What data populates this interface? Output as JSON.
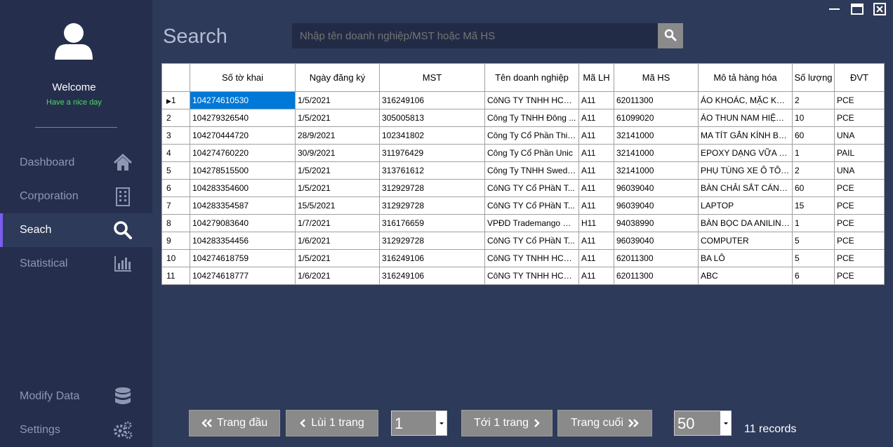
{
  "window": {
    "minimize_icon": "minimize-icon",
    "maximize_icon": "maximize-icon",
    "close_icon": "close-icon"
  },
  "sidebar": {
    "welcome": "Welcome",
    "subtitle": "Have a nice day",
    "items": [
      {
        "label": "Dashboard",
        "icon": "home-icon"
      },
      {
        "label": "Corporation",
        "icon": "building-icon"
      },
      {
        "label": "Seach",
        "icon": "search-icon",
        "active": true
      },
      {
        "label": "Statistical",
        "icon": "bar-chart-icon"
      },
      {
        "label": "Modify Data",
        "icon": "database-icon"
      },
      {
        "label": "Settings",
        "icon": "gears-icon"
      }
    ]
  },
  "search": {
    "title": "Search",
    "placeholder": "Nhập tên doanh nghiệp/MST hoặc Mã HS"
  },
  "table": {
    "columns": [
      "Số tờ khai",
      "Ngày đăng ký",
      "MST",
      "Tên doanh nghiệp",
      "Mã LH",
      "Mã HS",
      "Mô tả hàng hóa",
      "Số lượng",
      "ĐVT"
    ],
    "rows": [
      {
        "n": "1",
        "so": "104274610530",
        "ngay": "1/5/2021",
        "mst": "316249106",
        "ten": "CôNG TY TNHH HCM...",
        "malh": "A11",
        "mahs": "62011300",
        "mota": "ÁO KHOÁC, MẶC KHI...",
        "sl": "2",
        "dvt": "PCE"
      },
      {
        "n": "2",
        "so": "104279326540",
        "ngay": "1/5/2021",
        "mst": "305005813",
        "ten": "Công Ty TNHH Đông ...",
        "malh": "A11",
        "mahs": "61099020",
        "mota": "ÁO THUN NAM HIỆU ...",
        "sl": "10",
        "dvt": "PCE"
      },
      {
        "n": "3",
        "so": "104270444720",
        "ngay": "28/9/2021",
        "mst": "102341802",
        "ten": "Công Ty Cổ Phần Thiế...",
        "malh": "A11",
        "mahs": "32141000",
        "mota": "MA TÍT GẮN KÍNH BE...",
        "sl": "60",
        "dvt": "UNA"
      },
      {
        "n": "4",
        "so": "104274760220",
        "ngay": "30/9/2021",
        "mst": "311976429",
        "ten": "Công Ty Cổ Phần Unic",
        "malh": "A11",
        "mahs": "32141000",
        "mota": "EPOXY DẠNG VỮA DÙ...",
        "sl": "1",
        "dvt": "PAIL"
      },
      {
        "n": "5",
        "so": "104278515500",
        "ngay": "1/5/2021",
        "mst": "313761612",
        "ten": "Công Ty TNHH Swede...",
        "malh": "A11",
        "mahs": "32141000",
        "mota": "PHỤ TÙNG XE Ô TÔ C...",
        "sl": "2",
        "dvt": "UNA"
      },
      {
        "n": "6",
        "so": "104283354600",
        "ngay": "1/5/2021",
        "mst": "312929728",
        "ten": "CôNG TY Cổ PHầN T...",
        "malh": "A11",
        "mahs": "96039040",
        "mota": "BÀN CHẢI SẮT CÁN G...",
        "sl": "60",
        "dvt": "PCE"
      },
      {
        "n": "7",
        "so": "104283354587",
        "ngay": "15/5/2021",
        "mst": "312929728",
        "ten": "CôNG TY Cổ PHầN T...",
        "malh": "A11",
        "mahs": "96039040",
        "mota": "LAPTOP",
        "sl": "15",
        "dvt": "PCE"
      },
      {
        "n": "8",
        "so": "104279083640",
        "ngay": "1/7/2021",
        "mst": "316176659",
        "ten": "VPĐD Trademango So...",
        "malh": "H11",
        "mahs": "94038990",
        "mota": "BÀN BỌC DA ANILIN, ...",
        "sl": "1",
        "dvt": "PCE"
      },
      {
        "n": "9",
        "so": "104283354456",
        "ngay": "1/6/2021",
        "mst": "312929728",
        "ten": "CôNG TY Cổ PHầN T...",
        "malh": "A11",
        "mahs": "96039040",
        "mota": "COMPUTER",
        "sl": "5",
        "dvt": "PCE"
      },
      {
        "n": "10",
        "so": "104274618759",
        "ngay": "1/5/2021",
        "mst": "316249106",
        "ten": "CôNG TY TNHH HCM...",
        "malh": "A11",
        "mahs": "62011300",
        "mota": "BA LÔ",
        "sl": "5",
        "dvt": "PCE"
      },
      {
        "n": "11",
        "so": "104274618777",
        "ngay": "1/6/2021",
        "mst": "316249106",
        "ten": "CôNG TY TNHH HCM...",
        "malh": "A11",
        "mahs": "62011300",
        "mota": "ABC",
        "sl": "6",
        "dvt": "PCE"
      }
    ]
  },
  "pager": {
    "first": "Trang đầu",
    "prev": "Lùi 1 trang",
    "page": "1",
    "next": "Tới 1 trang",
    "last": "Trang cuối",
    "page_size": "50",
    "records": "11 records"
  },
  "colors": {
    "background": "#2e3a59",
    "sidebar": "#252f4d",
    "accent": "#7d5cf0",
    "greeting": "#4cd964",
    "selection": "#0078d7"
  }
}
